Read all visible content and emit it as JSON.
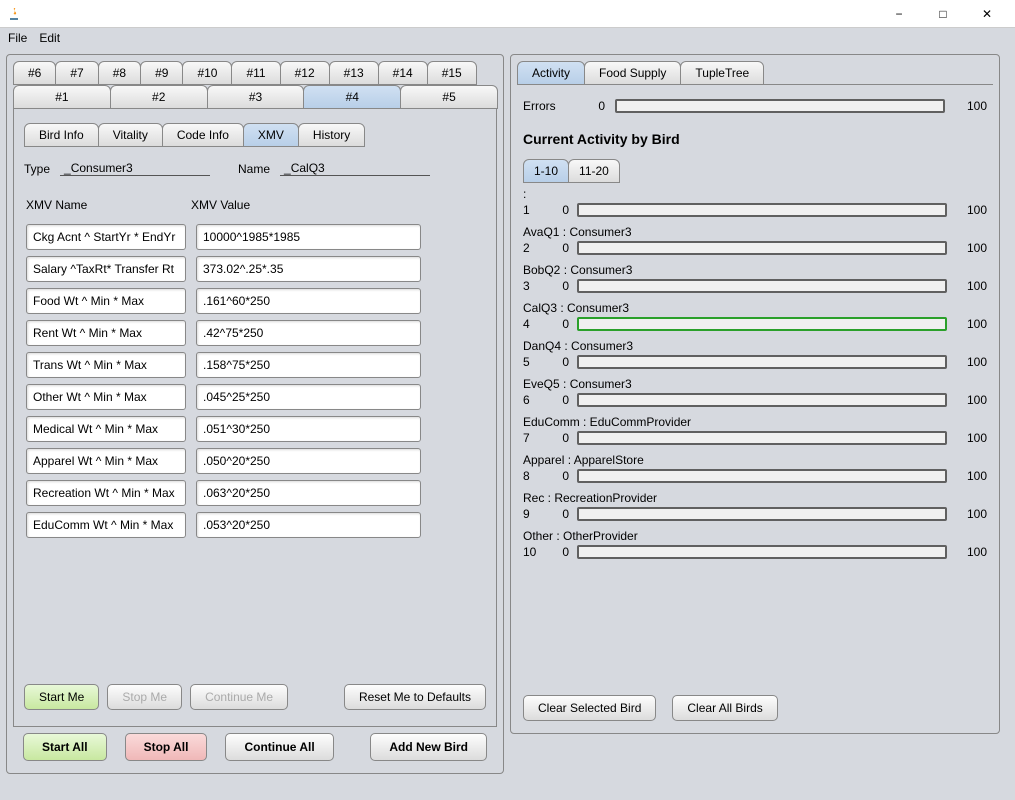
{
  "window": {
    "minimize": "−",
    "maximize": "□",
    "close": "✕"
  },
  "menu": {
    "file": "File",
    "edit": "Edit"
  },
  "main_tabs_top": [
    "#6",
    "#7",
    "#8",
    "#9",
    "#10",
    "#11",
    "#12",
    "#13",
    "#14",
    "#15"
  ],
  "main_tabs_bottom": [
    "#1",
    "#2",
    "#3",
    "#4",
    "#5"
  ],
  "main_tab_active": "#4",
  "sub_tabs": [
    "Bird Info",
    "Vitality",
    "Code Info",
    "XMV",
    "History"
  ],
  "sub_tab_active": "XMV",
  "info": {
    "type_label": "Type",
    "type_value": "_Consumer3",
    "name_label": "Name",
    "name_value": "_CalQ3"
  },
  "xmv_headers": {
    "name": "XMV Name",
    "value": "XMV Value"
  },
  "xmv_rows": [
    {
      "name": "Ckg Acnt ^ StartYr * EndYr",
      "value": "10000^1985*1985"
    },
    {
      "name": "Salary ^TaxRt* Transfer Rt",
      "value": "373.02^.25*.35"
    },
    {
      "name": "Food Wt ^ Min * Max",
      "value": ".161^60*250"
    },
    {
      "name": "Rent Wt ^ Min * Max",
      "value": ".42^75*250"
    },
    {
      "name": "Trans Wt ^ Min * Max",
      "value": ".158^75*250"
    },
    {
      "name": "Other Wt ^ Min * Max",
      "value": ".045^25*250"
    },
    {
      "name": "Medical Wt ^ Min * Max",
      "value": ".051^30*250"
    },
    {
      "name": "Apparel Wt ^ Min * Max",
      "value": ".050^20*250"
    },
    {
      "name": "Recreation Wt ^ Min * Max",
      "value": ".063^20*250"
    },
    {
      "name": "EduComm Wt ^ Min * Max",
      "value": ".053^20*250"
    }
  ],
  "left_btns": {
    "start": "Start Me",
    "stop": "Stop Me",
    "continue": "Continue Me",
    "reset": "Reset Me to Defaults"
  },
  "global_btns": {
    "start_all": "Start All",
    "stop_all": "Stop All",
    "continue_all": "Continue All",
    "add_bird": "Add New Bird"
  },
  "right_tabs": [
    "Activity",
    "Food Supply",
    "TupleTree"
  ],
  "right_tab_active": "Activity",
  "errors": {
    "label": "Errors",
    "value": "0",
    "max": "100"
  },
  "activity_title": "Current Activity by Bird",
  "page_tabs": [
    "1-10",
    "11-20"
  ],
  "page_tab_active": "1-10",
  "birds": [
    {
      "num": "1",
      "label": ":",
      "val": "0",
      "max": "100",
      "active": false
    },
    {
      "num": "2",
      "label": "AvaQ1 : Consumer3",
      "val": "0",
      "max": "100",
      "active": false
    },
    {
      "num": "3",
      "label": "BobQ2 : Consumer3",
      "val": "0",
      "max": "100",
      "active": false
    },
    {
      "num": "4",
      "label": "CalQ3 : Consumer3",
      "val": "0",
      "max": "100",
      "active": true
    },
    {
      "num": "5",
      "label": "DanQ4 : Consumer3",
      "val": "0",
      "max": "100",
      "active": false
    },
    {
      "num": "6",
      "label": "EveQ5 : Consumer3",
      "val": "0",
      "max": "100",
      "active": false
    },
    {
      "num": "7",
      "label": "EduComm : EduCommProvider",
      "val": "0",
      "max": "100",
      "active": false
    },
    {
      "num": "8",
      "label": "Apparel : ApparelStore",
      "val": "0",
      "max": "100",
      "active": false
    },
    {
      "num": "9",
      "label": "Rec : RecreationProvider",
      "val": "0",
      "max": "100",
      "active": false
    },
    {
      "num": "10",
      "label": "Other : OtherProvider",
      "val": "0",
      "max": "100",
      "active": false
    }
  ],
  "right_btns": {
    "clear_selected": "Clear Selected Bird",
    "clear_all": "Clear All Birds"
  }
}
